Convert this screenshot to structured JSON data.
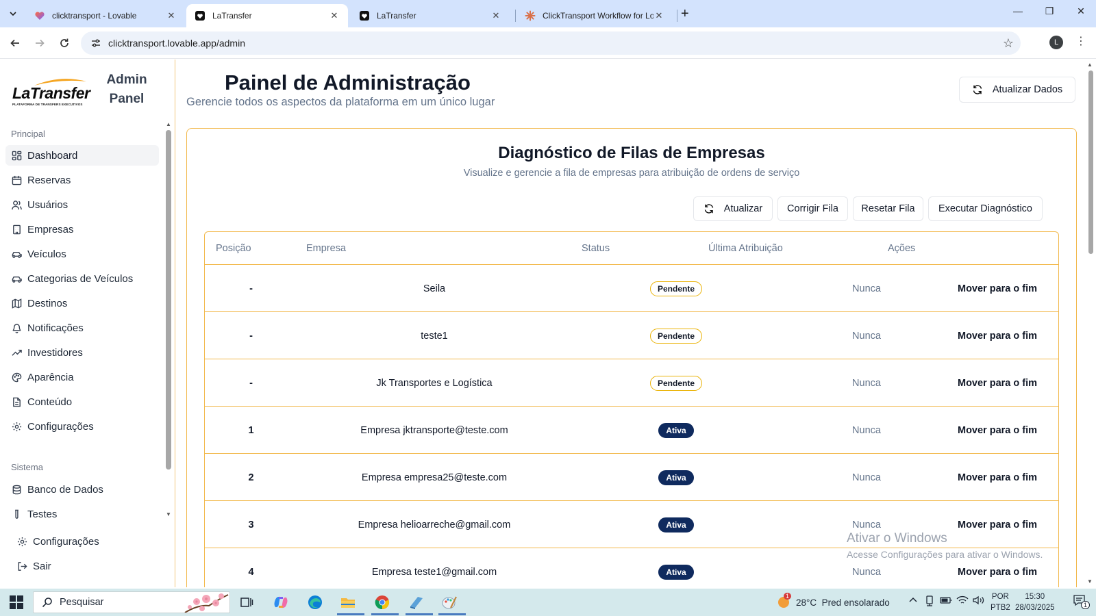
{
  "browser": {
    "tabs": [
      {
        "title": "clicktransport - Lovable",
        "favicon": "heart-icon"
      },
      {
        "title": "LaTransfer",
        "favicon": "lovable-icon",
        "active": true
      },
      {
        "title": "LaTransfer",
        "favicon": "lovable-icon"
      },
      {
        "title": "ClickTransport Workflow for Lov",
        "favicon": "claude-icon"
      }
    ],
    "url": "clicktransport.lovable.app/admin",
    "profile_initial": "L"
  },
  "sidebar": {
    "logo_text": "LaTransfer",
    "logo_subtext": "PLATAFORMA DE TRANSFERS EXECUTIVOS",
    "panel_title": "Admin Panel",
    "section_principal": "Principal",
    "principal_items": [
      {
        "label": "Dashboard",
        "icon": "dashboard-icon",
        "active": true
      },
      {
        "label": "Reservas",
        "icon": "calendar-icon"
      },
      {
        "label": "Usuários",
        "icon": "users-icon"
      },
      {
        "label": "Empresas",
        "icon": "building-icon"
      },
      {
        "label": "Veículos",
        "icon": "car-icon"
      },
      {
        "label": "Categorias de Veículos",
        "icon": "car-icon"
      },
      {
        "label": "Destinos",
        "icon": "map-icon"
      },
      {
        "label": "Notificações",
        "icon": "bell-icon"
      },
      {
        "label": "Investidores",
        "icon": "trending-up-icon"
      },
      {
        "label": "Aparência",
        "icon": "palette-icon"
      },
      {
        "label": "Conteúdo",
        "icon": "file-icon"
      },
      {
        "label": "Configurações",
        "icon": "gear-icon"
      }
    ],
    "section_sistema": "Sistema",
    "sistema_items": [
      {
        "label": "Banco de Dados",
        "icon": "database-icon"
      },
      {
        "label": "Testes",
        "icon": "test-tube-icon"
      }
    ],
    "footer_items": [
      {
        "label": "Configurações",
        "icon": "gear-icon"
      },
      {
        "label": "Sair",
        "icon": "logout-icon"
      }
    ]
  },
  "header": {
    "title": "Painel de Administração",
    "subtitle": "Gerencie todos os aspectos da plataforma em um único lugar",
    "refresh_button": "Atualizar Dados"
  },
  "queue_card": {
    "title": "Diagnóstico de Filas de Empresas",
    "subtitle": "Visualize e gerencie a fila de empresas para atribuição de ordens de serviço",
    "buttons": {
      "refresh": "Atualizar",
      "fix": "Corrigir Fila",
      "reset": "Resetar Fila",
      "diagnose": "Executar Diagnóstico"
    },
    "columns": [
      "Posição",
      "Empresa",
      "Status",
      "Última Atribuição",
      "Ações"
    ],
    "rows": [
      {
        "position": "-",
        "company": "Seila",
        "status": "Pendente",
        "last": "Nunca",
        "action": "Mover para o fim"
      },
      {
        "position": "-",
        "company": "teste1",
        "status": "Pendente",
        "last": "Nunca",
        "action": "Mover para o fim"
      },
      {
        "position": "-",
        "company": "Jk Transportes e Logística",
        "status": "Pendente",
        "last": "Nunca",
        "action": "Mover para o fim"
      },
      {
        "position": "1",
        "company": "Empresa jktransporte@teste.com",
        "status": "Ativa",
        "last": "Nunca",
        "action": "Mover para o fim"
      },
      {
        "position": "2",
        "company": "Empresa empresa25@teste.com",
        "status": "Ativa",
        "last": "Nunca",
        "action": "Mover para o fim"
      },
      {
        "position": "3",
        "company": "Empresa helioarreche@gmail.com",
        "status": "Ativa",
        "last": "Nunca",
        "action": "Mover para o fim"
      },
      {
        "position": "4",
        "company": "Empresa teste1@gmail.com",
        "status": "Ativa",
        "last": "Nunca",
        "action": "Mover para o fim"
      }
    ]
  },
  "watermark": {
    "line1": "Ativar o Windows",
    "line2": "Acesse Configurações para ativar o Windows."
  },
  "taskbar": {
    "search_label": "Pesquisar",
    "weather": "28°C  Pred ensolarado",
    "weather_badge": "1",
    "lang_line1": "POR",
    "lang_line2": "PTB2",
    "time": "15:30",
    "date": "28/03/2025",
    "notif_count": "1"
  },
  "colors": {
    "accent_border": "#f2b84a",
    "badge_active": "#0f2a5e",
    "badge_pending_border": "#eab308"
  }
}
